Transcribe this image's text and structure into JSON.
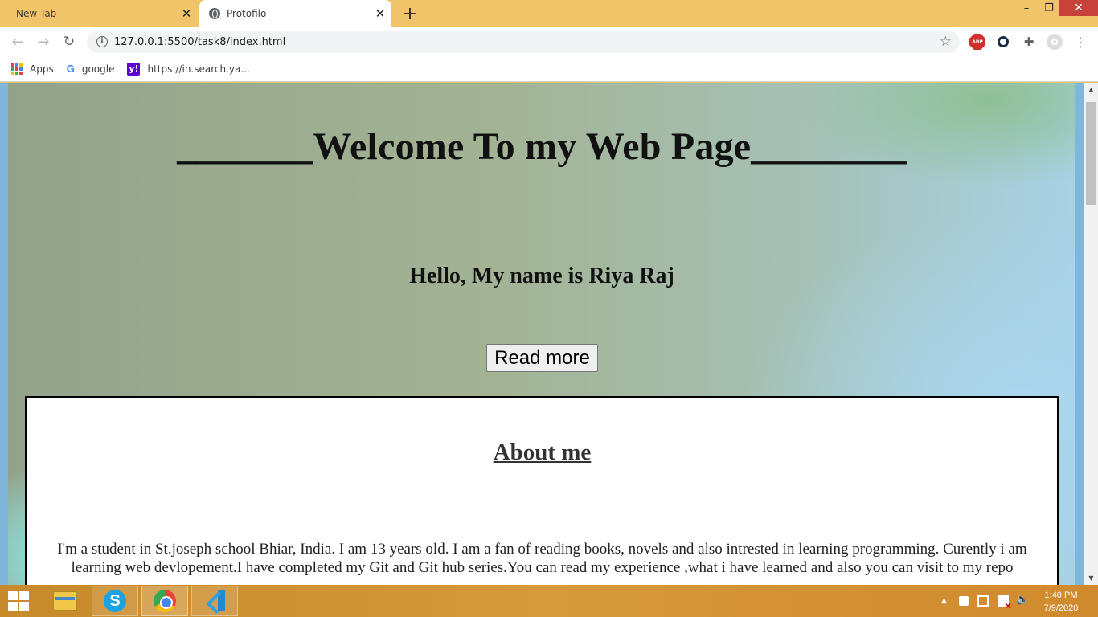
{
  "browser": {
    "tabs": [
      {
        "label": "New Tab",
        "active": false
      },
      {
        "label": "Protofilo",
        "active": true
      }
    ],
    "url": "127.0.0.1:5500/task8/index.html",
    "bookmarks": [
      {
        "label": "Apps",
        "icon": "apps-grid-icon"
      },
      {
        "label": "google",
        "icon": "google-icon"
      },
      {
        "label": "https://in.search.ya...",
        "icon": "yahoo-icon"
      }
    ],
    "extensions": [
      "adblock-plus-icon",
      "search-extension-icon",
      "puzzle-icon",
      "profile-avatar"
    ],
    "abp_text": "ABP"
  },
  "page": {
    "welcome": "_______Welcome To my Web Page________",
    "hello": "Hello, My name is Riya Raj",
    "read_more": "Read more",
    "about": {
      "title": "About me",
      "text": "I'm a student in St.joseph school Bhiar, India. I am 13 years old. I am a fan of reading books, novels and also intrested in learning programming. Curently i am learning web devlopement.I have completed my Git and Git hub series.You can read my experience ,what i have learned and also you can visit to my repo"
    }
  },
  "taskbar": {
    "apps": [
      "file-explorer",
      "skype",
      "chrome",
      "vscode"
    ],
    "time": "1:40 PM",
    "date": "7/9/2020"
  },
  "colors": {
    "tab_strip": "#f2c46a",
    "close_button": "#c7423a",
    "taskbar": "#d0902e"
  }
}
